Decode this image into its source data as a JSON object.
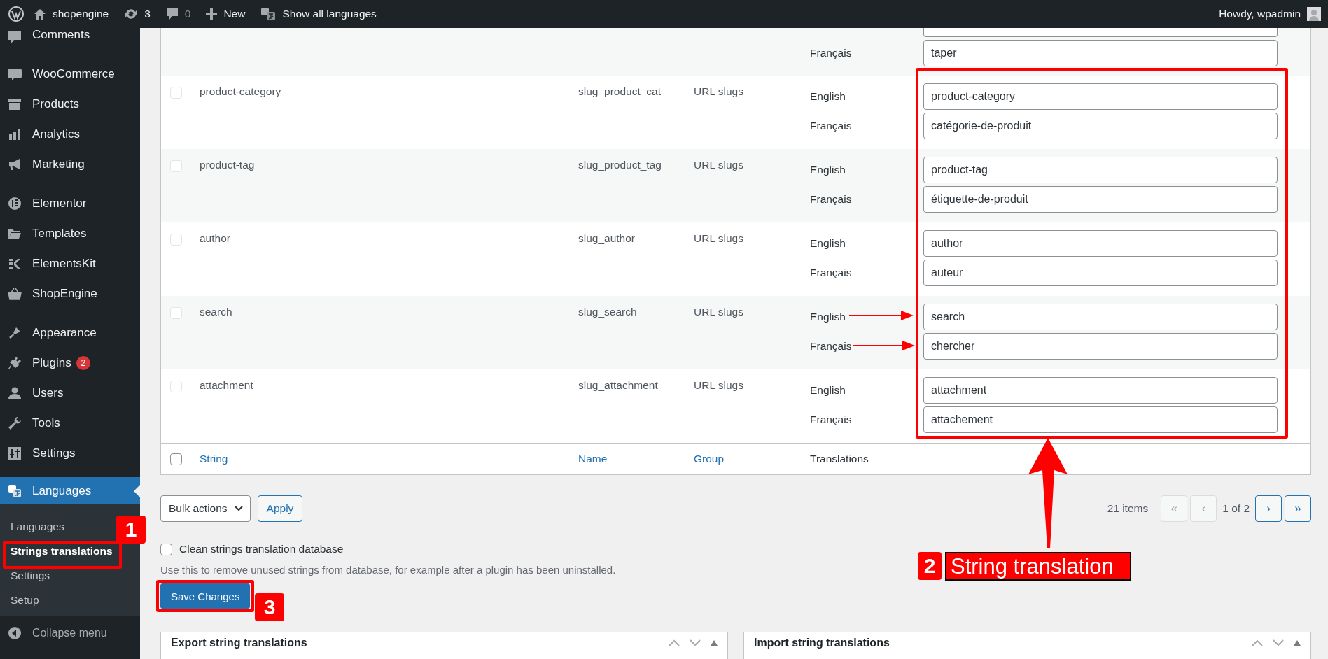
{
  "admin_bar": {
    "site": "shopengine",
    "updates": "3",
    "comments": "0",
    "new": "New",
    "languages": "Show all languages",
    "greeting": "Howdy, wpadmin"
  },
  "sidebar": {
    "groups": [
      [
        {
          "label": "Comments",
          "selected": false
        }
      ],
      [
        {
          "label": "WooCommerce",
          "selected": false
        },
        {
          "label": "Products",
          "selected": false
        },
        {
          "label": "Analytics",
          "selected": false
        },
        {
          "label": "Marketing",
          "selected": false
        }
      ],
      [
        {
          "label": "Elementor",
          "selected": false
        },
        {
          "label": "Templates",
          "selected": false
        },
        {
          "label": "ElementsKit",
          "selected": false
        },
        {
          "label": "ShopEngine",
          "selected": false
        }
      ],
      [
        {
          "label": "Appearance",
          "selected": false
        },
        {
          "label": "Plugins",
          "badge": "2",
          "selected": false
        },
        {
          "label": "Users",
          "selected": false
        },
        {
          "label": "Tools",
          "selected": false
        },
        {
          "label": "Settings",
          "selected": false
        }
      ],
      [
        {
          "label": "Languages",
          "selected": true,
          "children": [
            {
              "label": "Languages",
              "selected": false
            },
            {
              "label": "Strings translations",
              "selected": true
            },
            {
              "label": "Settings",
              "selected": false
            },
            {
              "label": "Setup",
              "selected": false
            }
          ]
        }
      ]
    ],
    "collapse": "Collapse menu"
  },
  "table": {
    "partial_row": {
      "translations": [
        {
          "language": "Français",
          "value": "taper"
        }
      ]
    },
    "rows": [
      {
        "string": "product-category",
        "name": "slug_product_cat",
        "group": "URL slugs",
        "checked": false,
        "translations": [
          {
            "language": "English",
            "value": "product-category"
          },
          {
            "language": "Français",
            "value": "catégorie-de-produit"
          }
        ]
      },
      {
        "string": "product-tag",
        "name": "slug_product_tag",
        "group": "URL slugs",
        "checked": false,
        "translations": [
          {
            "language": "English",
            "value": "product-tag"
          },
          {
            "language": "Français",
            "value": "étiquette-de-produit"
          }
        ]
      },
      {
        "string": "author",
        "name": "slug_author",
        "group": "URL slugs",
        "checked": false,
        "translations": [
          {
            "language": "English",
            "value": "author"
          },
          {
            "language": "Français",
            "value": "auteur"
          }
        ]
      },
      {
        "string": "search",
        "name": "slug_search",
        "group": "URL slugs",
        "checked": false,
        "translations": [
          {
            "language": "English",
            "value": "search"
          },
          {
            "language": "Français",
            "value": "chercher"
          }
        ]
      },
      {
        "string": "attachment",
        "name": "slug_attachment",
        "group": "URL slugs",
        "checked": false,
        "translations": [
          {
            "language": "English",
            "value": "attachment"
          },
          {
            "language": "Français",
            "value": "attachement"
          }
        ]
      }
    ],
    "footer": {
      "checked": false,
      "columns": [
        "String",
        "Name",
        "Group",
        "Translations"
      ]
    }
  },
  "bulk_actions": {
    "select": "Bulk actions",
    "apply": "Apply"
  },
  "pagination": {
    "count": "21 items",
    "page": "1 of 2",
    "buttons": [
      {
        "label": "«",
        "disabled": true
      },
      {
        "label": "‹",
        "disabled": true
      },
      {
        "label": "›",
        "disabled": false
      },
      {
        "label": "»",
        "disabled": false
      }
    ]
  },
  "clean": {
    "label": "Clean strings translation database",
    "checked": false,
    "description": "Use this to remove unused strings from database, for example after a plugin has been uninstalled."
  },
  "save": "Save Changes",
  "panels": [
    {
      "title": "Export string translations"
    },
    {
      "title": "Import string translations"
    }
  ],
  "annotations": [
    {
      "number": "1"
    },
    {
      "number": "2",
      "label": "String translation"
    },
    {
      "number": "3"
    }
  ]
}
